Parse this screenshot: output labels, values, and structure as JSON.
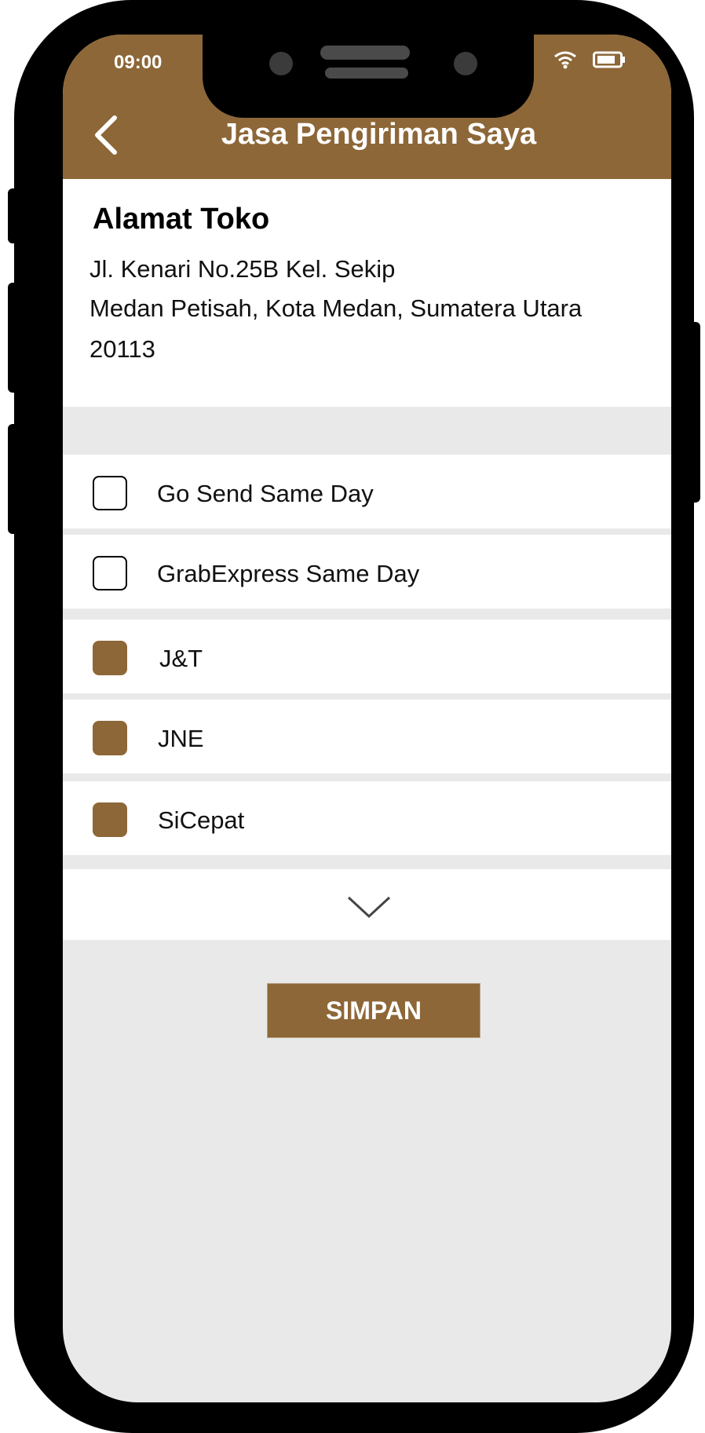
{
  "status_bar": {
    "time": "09:00",
    "wifi_icon": "wifi-icon",
    "battery_icon": "battery-icon"
  },
  "header": {
    "title": "Jasa Pengiriman Saya",
    "back_icon": "chevron-left-icon"
  },
  "address": {
    "heading": "Alamat Toko",
    "lines": [
      "Jl. Kenari No.25B Kel. Sekip",
      "Medan Petisah, Kota Medan, Sumatera Utara",
      "20113"
    ]
  },
  "couriers": [
    {
      "label": "Go Send Same Day",
      "checked": false
    },
    {
      "label": "GrabExpress Same Day",
      "checked": false
    },
    {
      "label": "J&T",
      "checked": true
    },
    {
      "label": "JNE",
      "checked": true
    },
    {
      "label": "SiCepat",
      "checked": true
    }
  ],
  "expand_icon": "chevron-down-icon",
  "save_button": {
    "label": "SIMPAN"
  },
  "colors": {
    "accent": "#8d6738",
    "background": "#e9e9e9"
  }
}
